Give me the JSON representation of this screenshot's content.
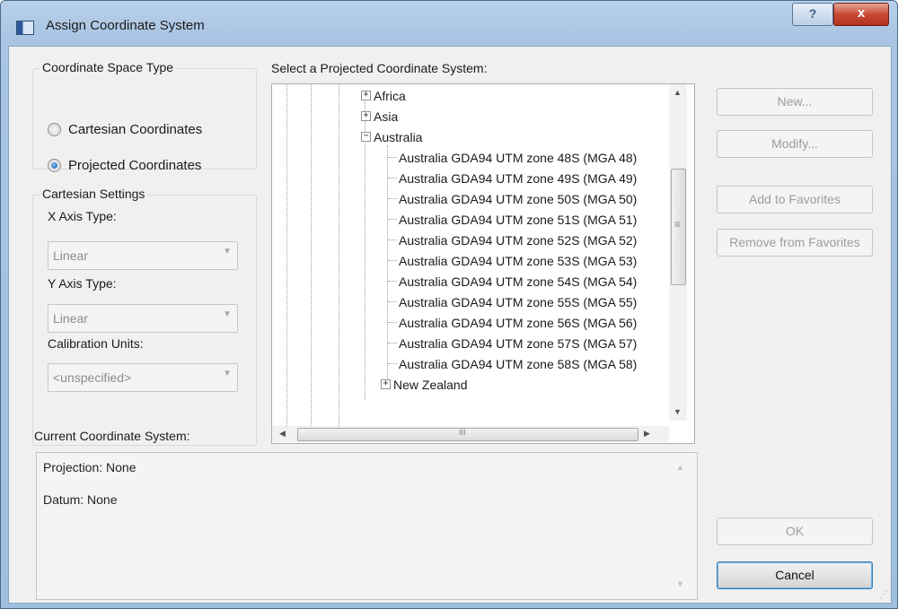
{
  "window": {
    "title": "Assign Coordinate System",
    "help_label": "?",
    "close_label": "x"
  },
  "space_type": {
    "legend": "Coordinate Space Type",
    "options": [
      {
        "label": "Cartesian Coordinates",
        "checked": false
      },
      {
        "label": "Projected Coordinates",
        "checked": true
      }
    ]
  },
  "cartesian": {
    "legend": "Cartesian Settings",
    "x_axis_label": "X Axis Type:",
    "x_axis_value": "Linear",
    "y_axis_label": "Y Axis Type:",
    "y_axis_value": "Linear",
    "units_label": "Calibration Units:",
    "units_value": "<unspecified>"
  },
  "tree": {
    "label": "Select a Projected Coordinate System:",
    "nodes": [
      {
        "label": "Africa",
        "type": "collapsed"
      },
      {
        "label": "Asia",
        "type": "collapsed"
      },
      {
        "label": "Australia",
        "type": "expanded"
      },
      {
        "label": "Australia GDA94 UTM zone 48S (MGA 48)",
        "type": "leaf"
      },
      {
        "label": "Australia GDA94 UTM zone 49S (MGA 49)",
        "type": "leaf"
      },
      {
        "label": "Australia GDA94 UTM zone 50S (MGA 50)",
        "type": "leaf"
      },
      {
        "label": "Australia GDA94 UTM zone 51S (MGA 51)",
        "type": "leaf"
      },
      {
        "label": "Australia GDA94 UTM zone 52S (MGA 52)",
        "type": "leaf"
      },
      {
        "label": "Australia GDA94 UTM zone 53S (MGA 53)",
        "type": "leaf"
      },
      {
        "label": "Australia GDA94 UTM zone 54S (MGA 54)",
        "type": "leaf"
      },
      {
        "label": "Australia GDA94 UTM zone 55S (MGA 55)",
        "type": "leaf"
      },
      {
        "label": "Australia GDA94 UTM zone 56S (MGA 56)",
        "type": "leaf"
      },
      {
        "label": "Australia GDA94 UTM zone 57S (MGA 57)",
        "type": "leaf"
      },
      {
        "label": "Australia GDA94 UTM zone 58S (MGA 58)",
        "type": "leaf"
      },
      {
        "label": "New Zealand",
        "type": "collapsed"
      }
    ],
    "grip_symbol": "≡",
    "hscroll_grip": "III"
  },
  "buttons": {
    "new": "New...",
    "modify": "Modify...",
    "add_favorites": "Add to Favorites",
    "remove_favorites": "Remove from Favorites",
    "ok": "OK",
    "cancel": "Cancel"
  },
  "current": {
    "label": "Current Coordinate System:",
    "projection": "Projection: None",
    "datum": "Datum: None"
  },
  "colors": {
    "title_bar": "#a9c5e3",
    "close_button": "#c74a35",
    "selected_radio": "#1a5fb0"
  }
}
